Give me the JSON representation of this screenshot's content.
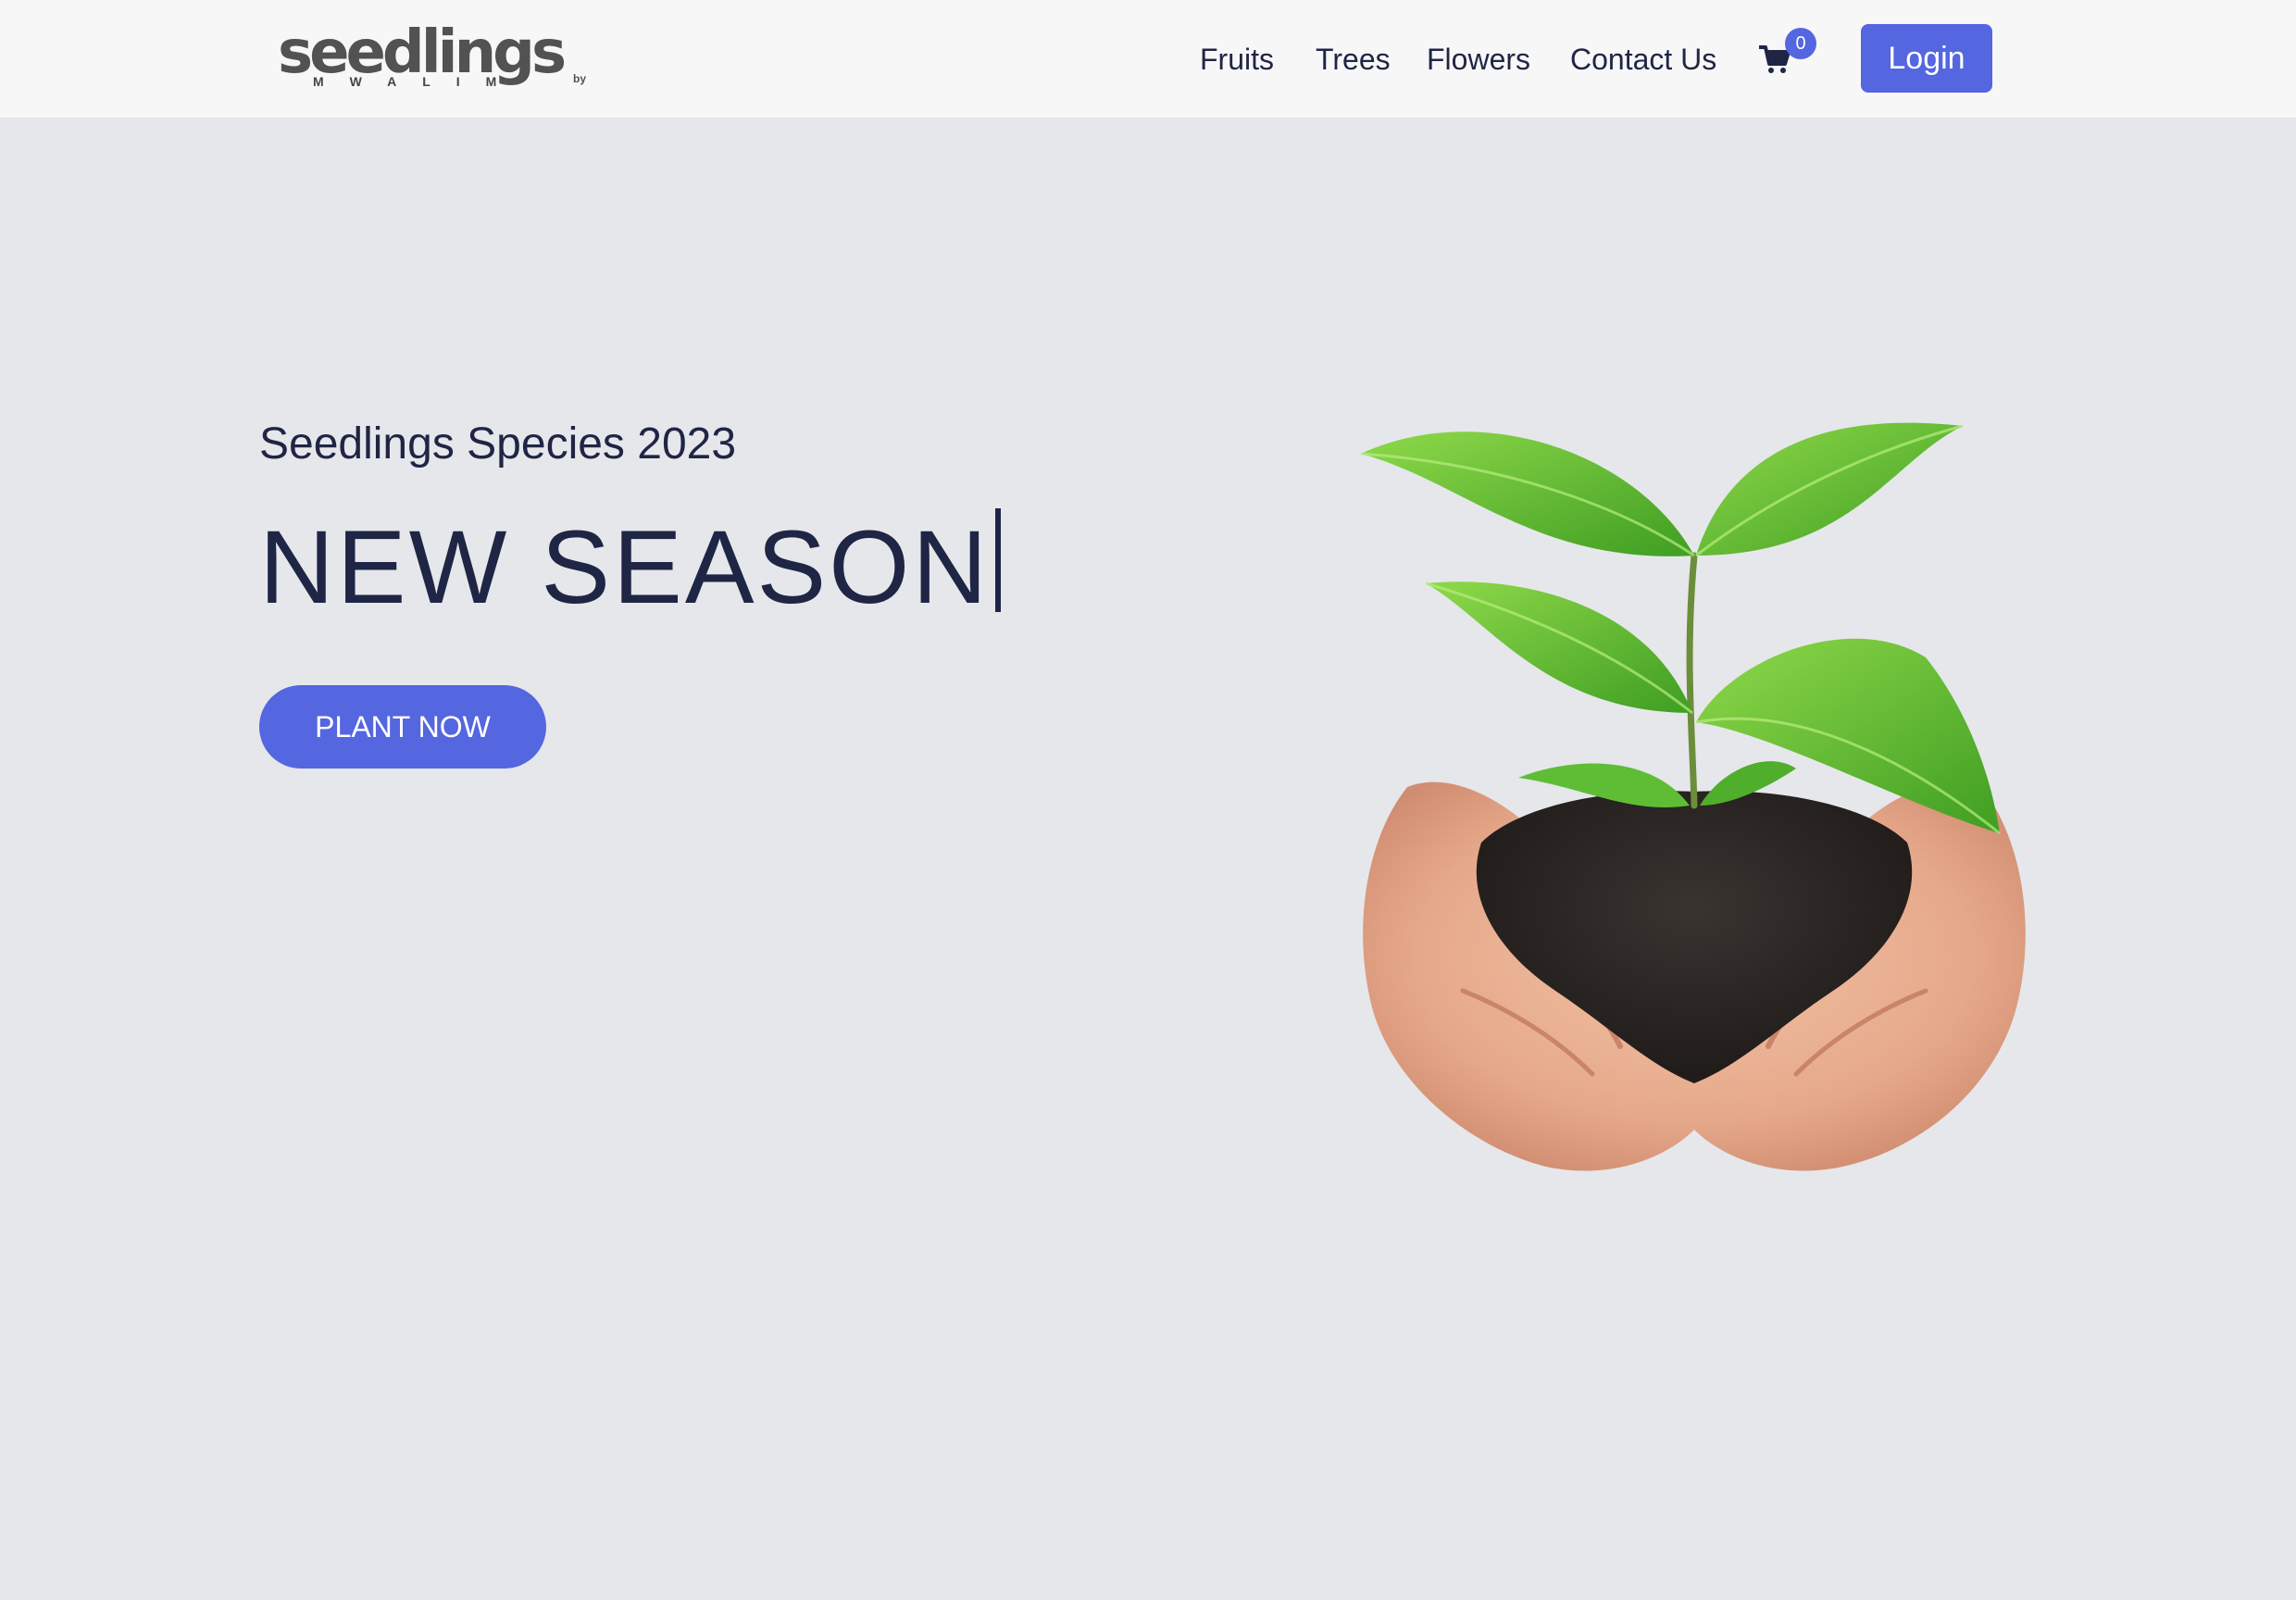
{
  "brand": {
    "name": "seedlings",
    "by": "by",
    "owner": "MWALIM"
  },
  "nav": {
    "links": [
      "Fruits",
      "Trees",
      "Flowers",
      "Contact Us"
    ],
    "cart_icon": "shopping-cart-icon",
    "cart_count": "0",
    "login_label": "Login"
  },
  "hero": {
    "subtitle": "Seedlings Species 2023",
    "headline": "NEW SEASON",
    "cta_label": "PLANT NOW",
    "image_subject": "hands-holding-seedling-in-soil"
  },
  "colors": {
    "accent": "#5466e0",
    "text": "#1f2544",
    "page_background": "#e5e7eb",
    "navbar_background": "#f7f7f7"
  }
}
